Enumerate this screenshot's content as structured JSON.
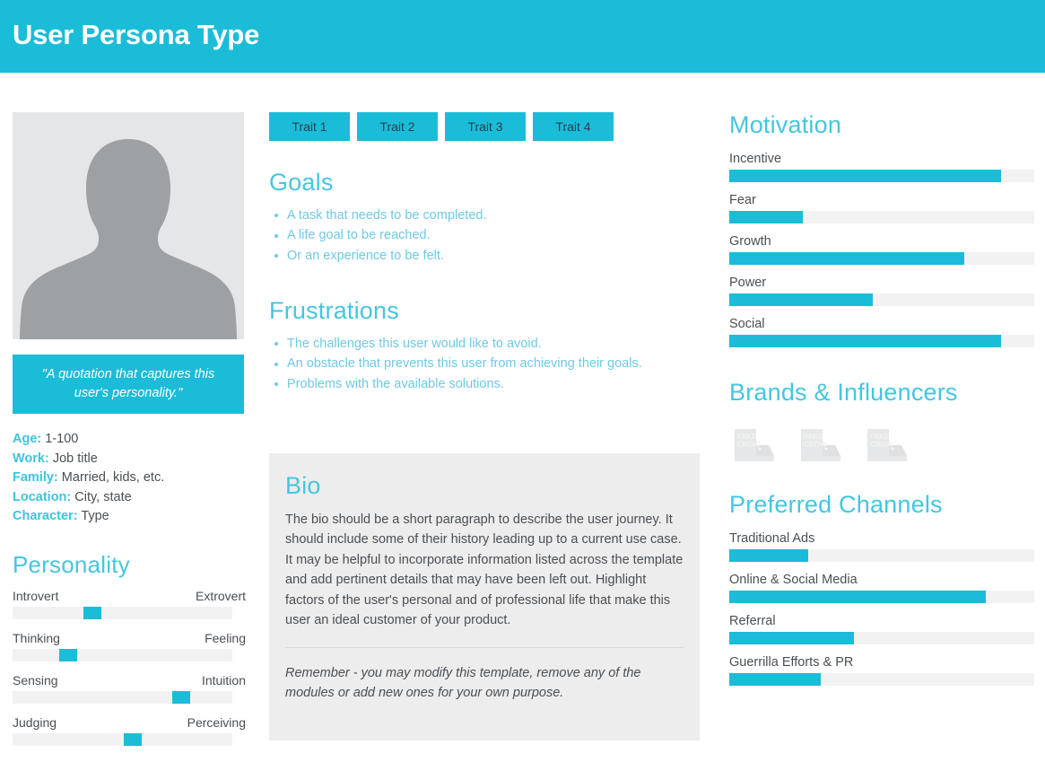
{
  "header": {
    "title": "User Persona Type"
  },
  "avatar": {
    "name": "person-silhouette-placeholder"
  },
  "quote": {
    "text": "\"A quotation that captures this user's personality.\""
  },
  "demographics": [
    {
      "label": "Age:",
      "value": "1-100"
    },
    {
      "label": "Work:",
      "value": "Job title"
    },
    {
      "label": "Family:",
      "value": "Married, kids, etc."
    },
    {
      "label": "Location:",
      "value": "City, state"
    },
    {
      "label": "Character:",
      "value": "Type"
    }
  ],
  "personality": {
    "heading": "Personality",
    "sliders": [
      {
        "left": "Introvert",
        "right": "Extrovert",
        "value": 35
      },
      {
        "left": "Thinking",
        "right": "Feeling",
        "value": 23
      },
      {
        "left": "Sensing",
        "right": "Intuition",
        "value": 79
      },
      {
        "left": "Judging",
        "right": "Perceiving",
        "value": 55
      }
    ]
  },
  "traits": [
    "Trait 1",
    "Trait 2",
    "Trait 3",
    "Trait 4"
  ],
  "goals": {
    "heading": "Goals",
    "items": [
      "A task that needs to be completed.",
      "A life goal to be reached.",
      "Or an experience to be felt."
    ]
  },
  "frustrations": {
    "heading": "Frustrations",
    "items": [
      "The challenges this user would like to avoid.",
      "An obstacle that prevents this user from achieving their goals.",
      "Problems with the available solutions."
    ]
  },
  "bio": {
    "heading": "Bio",
    "text": "The bio should be a short paragraph to describe the user journey. It should include some of their history leading up to a current use case. It may be helpful to incorporate information listed across the template and add pertinent details that may have been left out. Highlight factors of the user's personal and of professional life that make this user an ideal customer of your product.",
    "note": "Remember - you may modify this template, remove any of the modules or add new ones for your own purpose."
  },
  "motivation": {
    "heading": "Motivation",
    "bars": [
      {
        "label": "Incentive",
        "value": 89
      },
      {
        "label": "Fear",
        "value": 24
      },
      {
        "label": "Growth",
        "value": 77
      },
      {
        "label": "Power",
        "value": 47
      },
      {
        "label": "Social",
        "value": 89
      }
    ]
  },
  "brands": {
    "heading": "Brands & Influencers",
    "logos": [
      "fake-crow-logo",
      "fake-crow-logo",
      "fake-crow-logo"
    ],
    "logo_text_line1": "FAKE",
    "logo_text_line2": "CROW"
  },
  "channels": {
    "heading": "Preferred Channels",
    "bars": [
      {
        "label": "Traditional Ads",
        "value": 26
      },
      {
        "label": "Online & Social Media",
        "value": 84
      },
      {
        "label": "Referral",
        "value": 41
      },
      {
        "label": "Guerrilla Efforts & PR",
        "value": 30
      }
    ]
  },
  "colors": {
    "brand_cyan": "#1BBCD8",
    "heading_cyan": "#45C6E0",
    "bullet_blue": "#6EC9E4",
    "text_dark": "#4A4F54",
    "track_gray": "#F2F2F2",
    "panel_gray": "#EDEDED"
  }
}
